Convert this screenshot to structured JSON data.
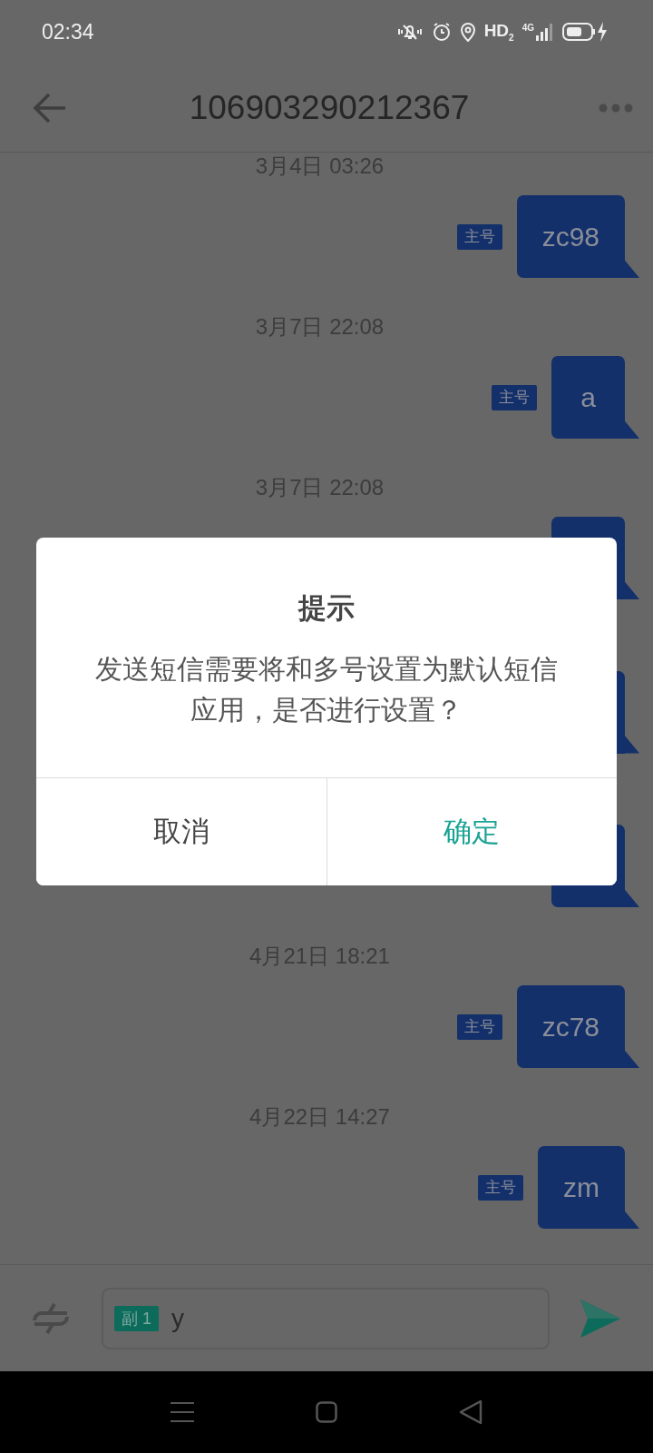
{
  "status_bar": {
    "time": "02:34",
    "network_label": "HD$_{2}$",
    "signal_label": "4G"
  },
  "header": {
    "title": "106903290212367"
  },
  "messages": [
    {
      "kind": "date",
      "text": "3月4日 03:26"
    },
    {
      "kind": "sent",
      "text": "zc98",
      "sim": "主号"
    },
    {
      "kind": "date",
      "text": "3月7日 22:08"
    },
    {
      "kind": "sent",
      "text": "a",
      "sim": "主号"
    },
    {
      "kind": "date",
      "text": "3月7日 22:08"
    },
    {
      "kind": "sent"
    },
    {
      "kind": "date"
    },
    {
      "kind": "sent"
    },
    {
      "kind": "date"
    },
    {
      "kind": "sent"
    },
    {
      "kind": "date",
      "text": "4月21日 18:21"
    },
    {
      "kind": "sent",
      "text": "zc78",
      "sim": "主号"
    },
    {
      "kind": "date",
      "text": "4月22日 14:27"
    },
    {
      "kind": "sent",
      "text": "zm",
      "sim": "主号"
    }
  ],
  "compose": {
    "sim": "副 1",
    "value": "y"
  },
  "dialog": {
    "title": "提示",
    "message": "发送短信需要将和多号设置为默认短信应用，是否进行设置？",
    "buttons": [
      {
        "kind": "cancel",
        "label": "取消"
      },
      {
        "kind": "confirm",
        "label": "确定"
      }
    ]
  }
}
